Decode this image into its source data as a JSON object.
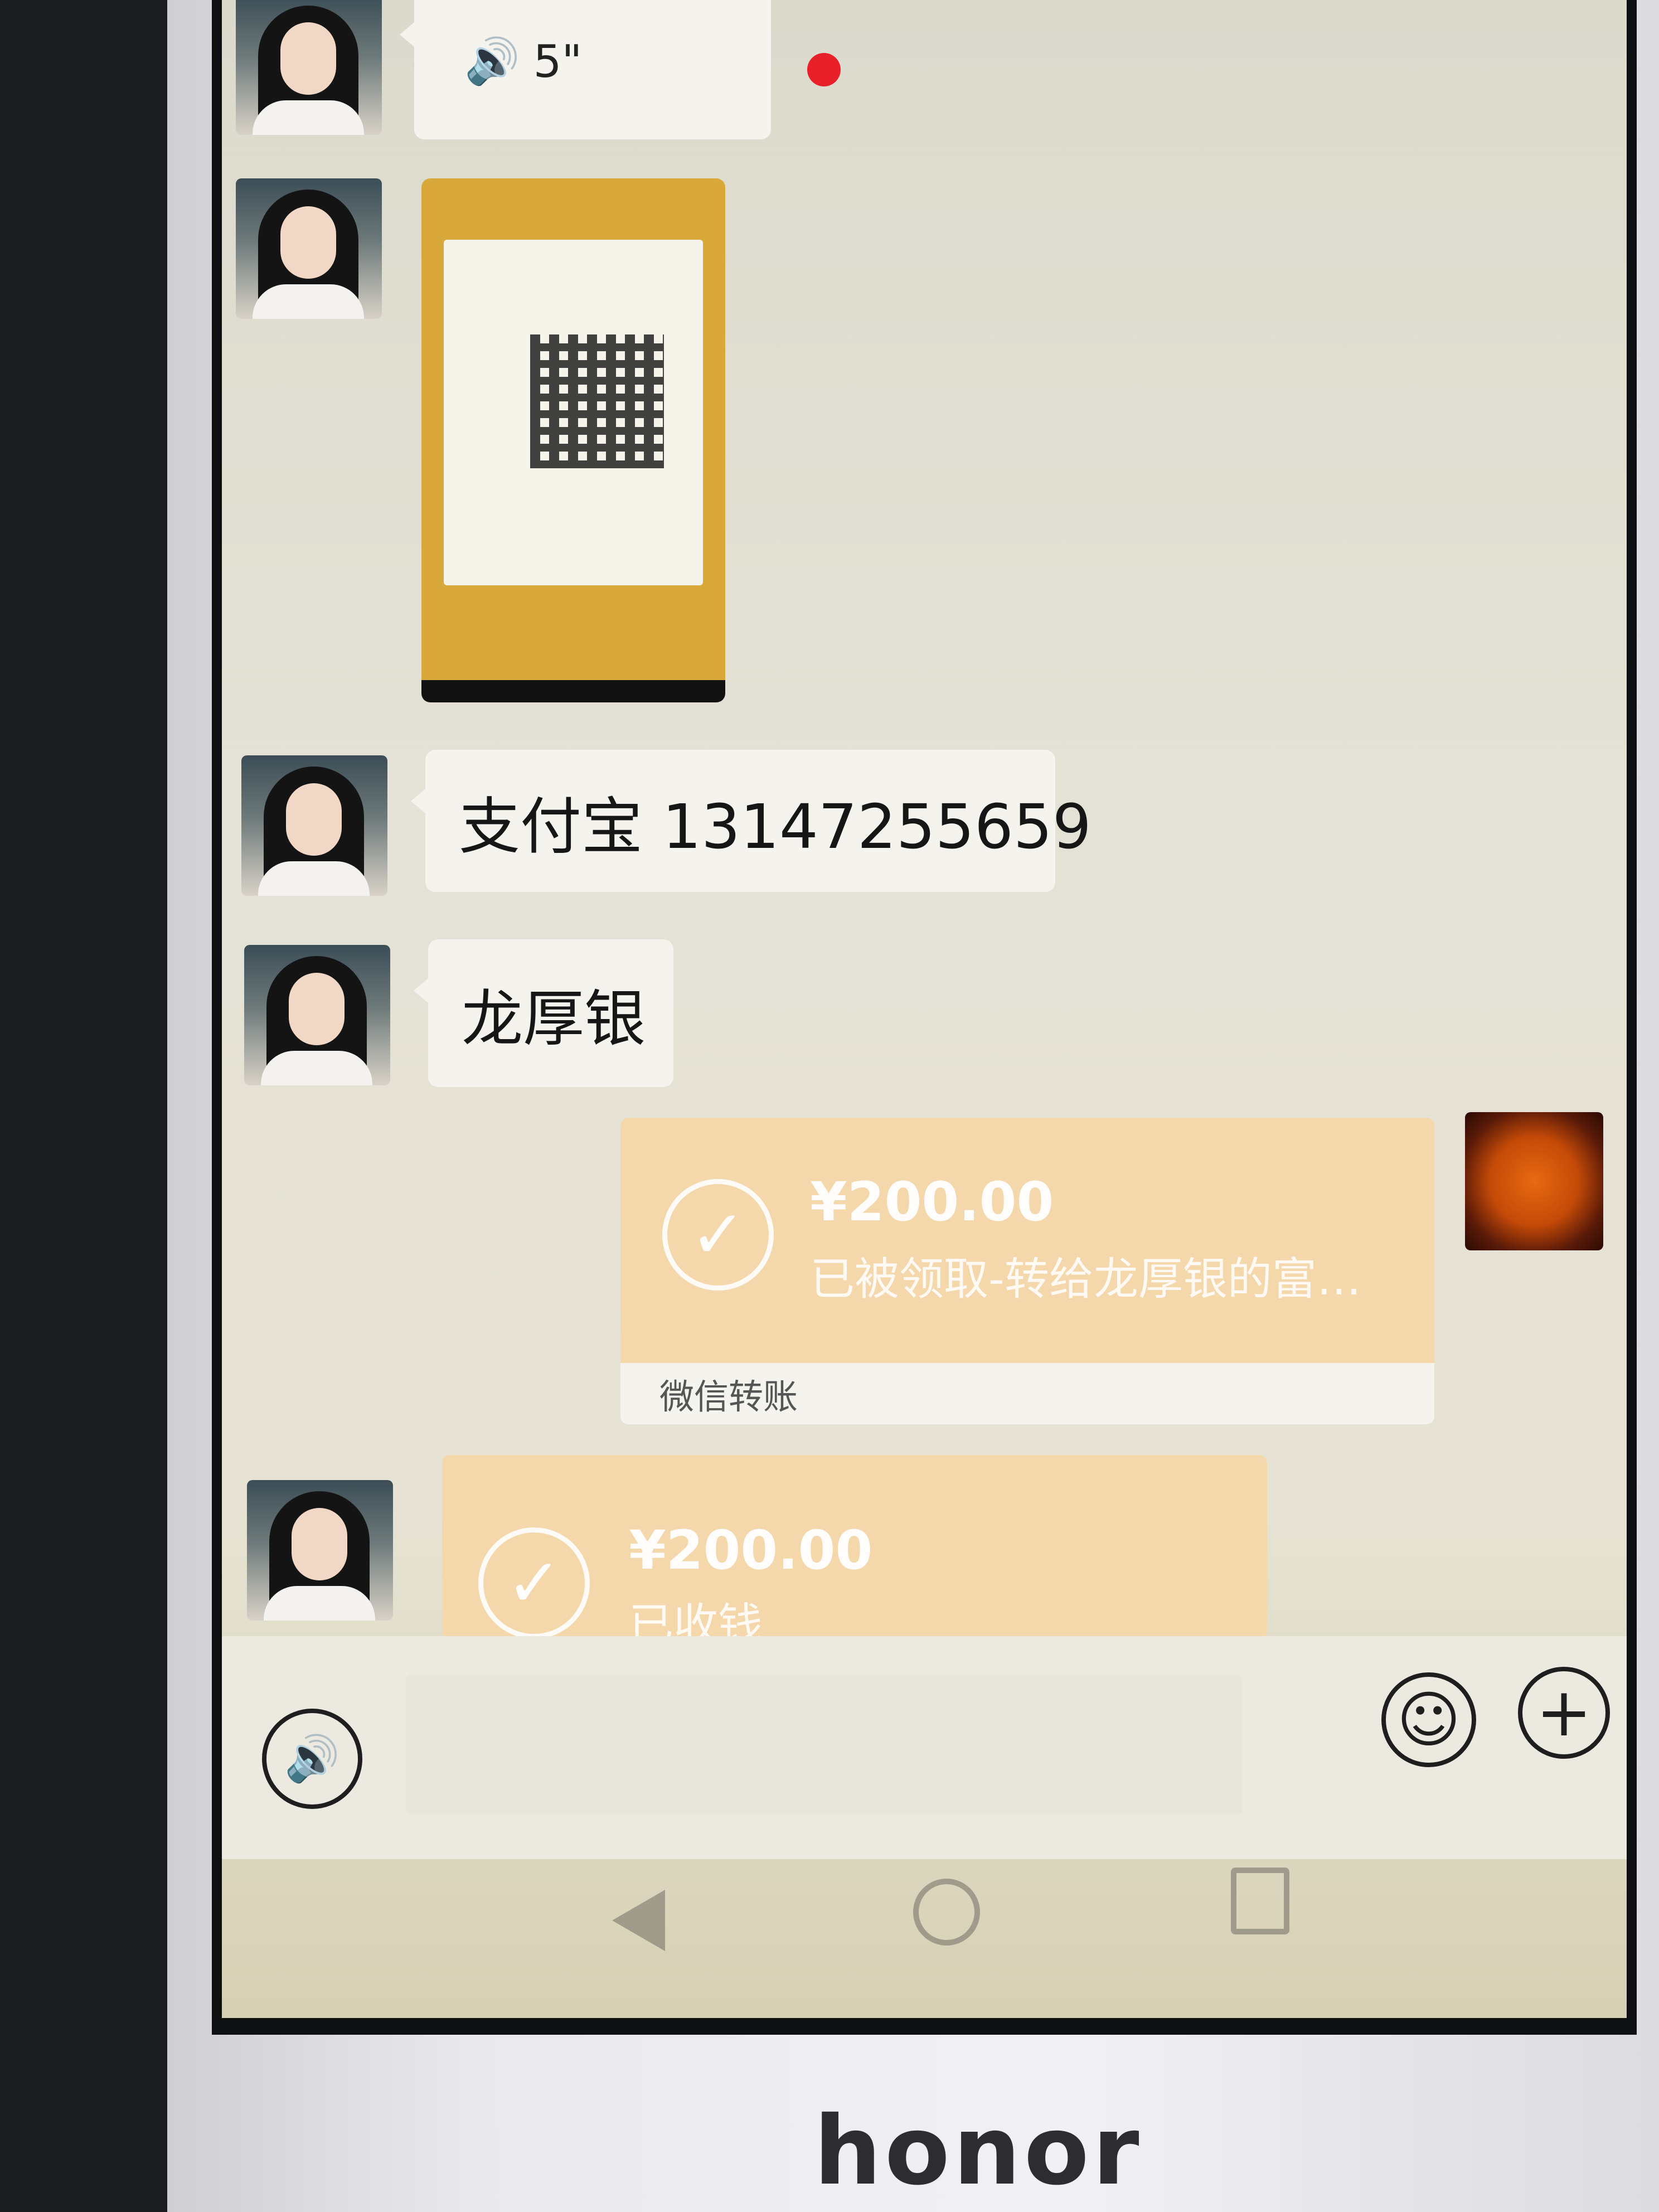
{
  "brand": {
    "logo_text": "honor"
  },
  "messages": {
    "voice": {
      "duration": "5\""
    },
    "alipay": {
      "text": "支付宝 13147255659"
    },
    "name": {
      "text": "龙厚银"
    },
    "transfer_sent": {
      "amount": "¥200.00",
      "status": "已被领取-转给龙厚银的富…",
      "footer": "微信转账"
    },
    "transfer_received": {
      "amount": "¥200.00",
      "status": "已收钱"
    }
  },
  "icons": {
    "voice_wave": "voice-wave-icon",
    "check": "check-icon",
    "emoji": "emoji-icon",
    "plus": "plus-icon",
    "back": "back-triangle-icon",
    "home": "home-circle-icon",
    "recents": "recents-square-icon"
  },
  "colors": {
    "transfer_bg": "#f4d8ac",
    "bubble_bg": "#f4f3ee",
    "unread_dot": "#e8202a"
  }
}
